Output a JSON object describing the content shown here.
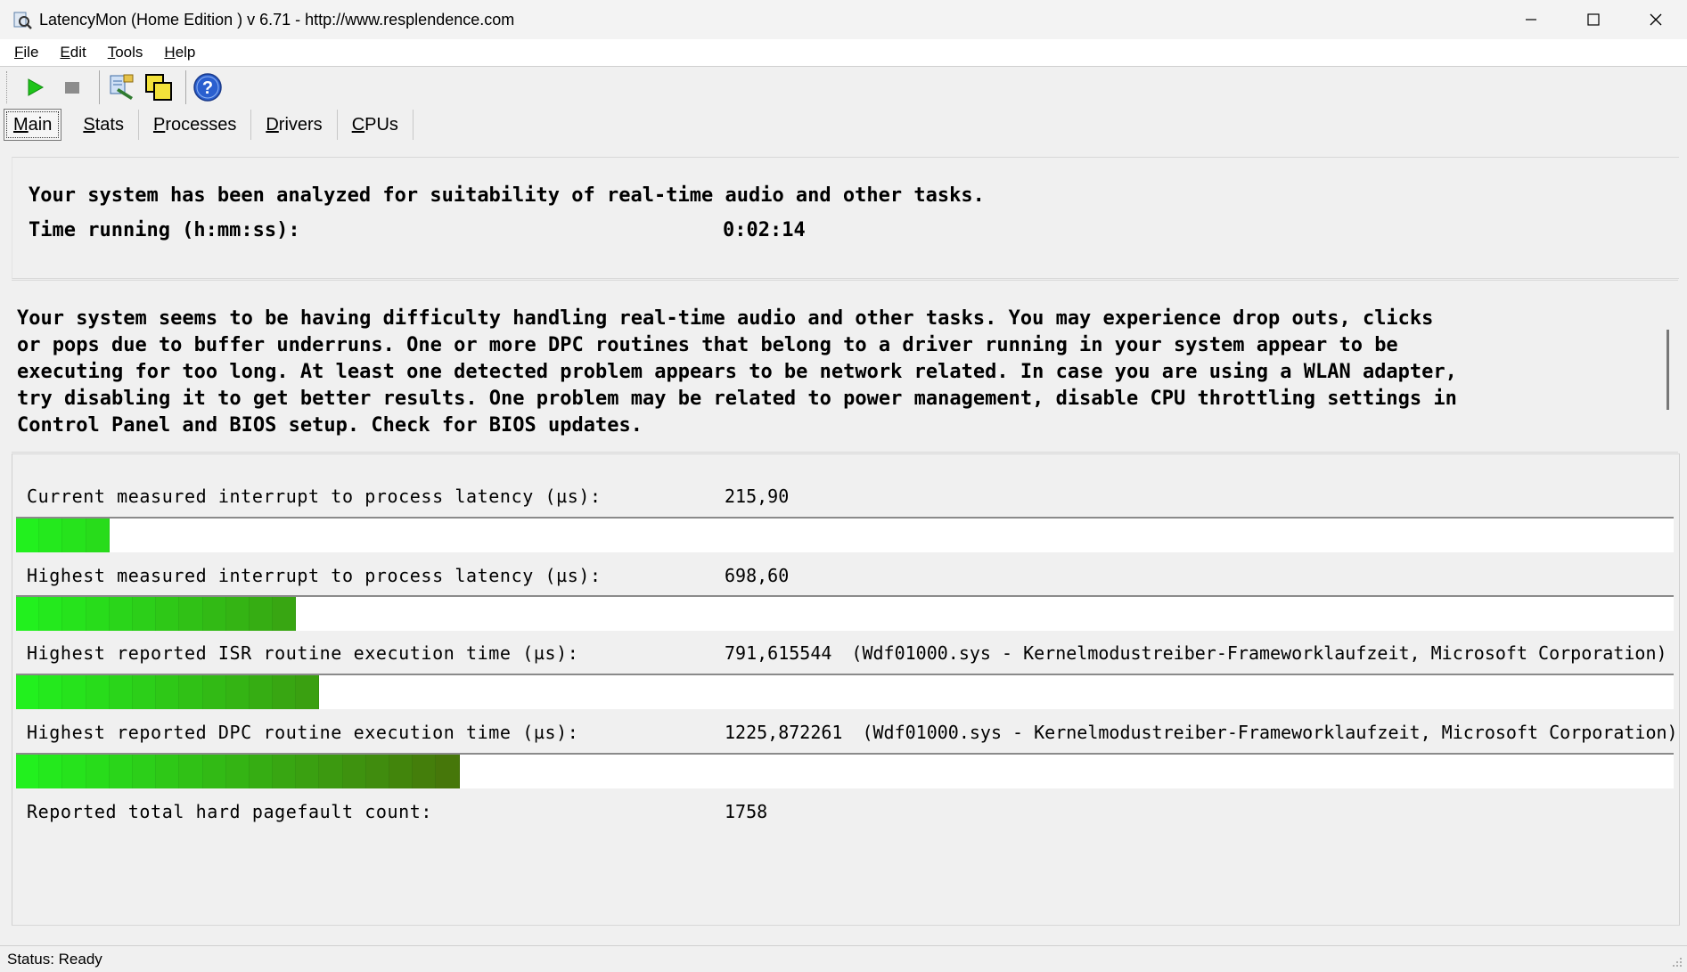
{
  "window": {
    "title": "LatencyMon  (Home Edition )  v 6.71 - http://www.resplendence.com"
  },
  "menu": [
    {
      "label": "File",
      "accel": "F",
      "rest": "ile"
    },
    {
      "label": "Edit",
      "accel": "E",
      "rest": "dit"
    },
    {
      "label": "Tools",
      "accel": "T",
      "rest": "ools"
    },
    {
      "label": "Help",
      "accel": "H",
      "rest": "elp"
    }
  ],
  "toolbar": {
    "icons": [
      "play-icon",
      "stop-icon",
      "tools-icon",
      "window-icon",
      "help-icon"
    ]
  },
  "tabs": [
    {
      "label": "Main",
      "accel": "M",
      "rest": "ain",
      "active": true
    },
    {
      "label": "Stats",
      "accel": "S",
      "rest": "tats",
      "active": false
    },
    {
      "label": "Processes",
      "accel": "P",
      "rest": "rocesses",
      "active": false
    },
    {
      "label": "Drivers",
      "accel": "D",
      "rest": "rivers",
      "active": false
    },
    {
      "label": "CPUs",
      "accel": "C",
      "rest": "PUs",
      "active": false
    }
  ],
  "summary": {
    "analyzed": "Your system has been analyzed for suitability of real-time audio and other tasks.",
    "time_label": "Time running (h:mm:ss):",
    "time_value": "0:02:14"
  },
  "verdict": "Your system seems to be having difficulty handling real-time audio and other tasks. You may experience drop outs, clicks\nor pops due to buffer underruns. One or more DPC routines that belong to a driver running in your system appear to be\nexecuting for too long. At least one detected problem appears to be network related. In case you are using a WLAN adapter,\ntry disabling it to get better results. One problem may be related to power management, disable CPU throttling settings in\nControl Panel and BIOS setup. Check for BIOS updates.",
  "metrics": [
    {
      "label": "Current measured interrupt to process latency (µs):",
      "value": "215,90",
      "extra": "",
      "segments": 4
    },
    {
      "label": "Highest measured interrupt to process latency (µs):",
      "value": "698,60",
      "extra": "",
      "segments": 12
    },
    {
      "label": "Highest reported ISR routine execution time (µs):",
      "value": "791,615544",
      "extra": "(Wdf01000.sys - Kernelmodustreiber-Frameworklaufzeit, Microsoft Corporation)",
      "segments": 13
    },
    {
      "label": "Highest reported DPC routine execution time (µs):",
      "value": "1225,872261",
      "extra": "(Wdf01000.sys - Kernelmodustreiber-Frameworklaufzeit, Microsoft Corporation)",
      "segments": 19
    },
    {
      "label": "Reported total hard pagefault count:",
      "value": "1758",
      "extra": "",
      "segments": 0
    }
  ],
  "status": "Status: Ready",
  "colors": {
    "bar_bright": "#22f01e",
    "bar_dark": "#4a6a08"
  }
}
